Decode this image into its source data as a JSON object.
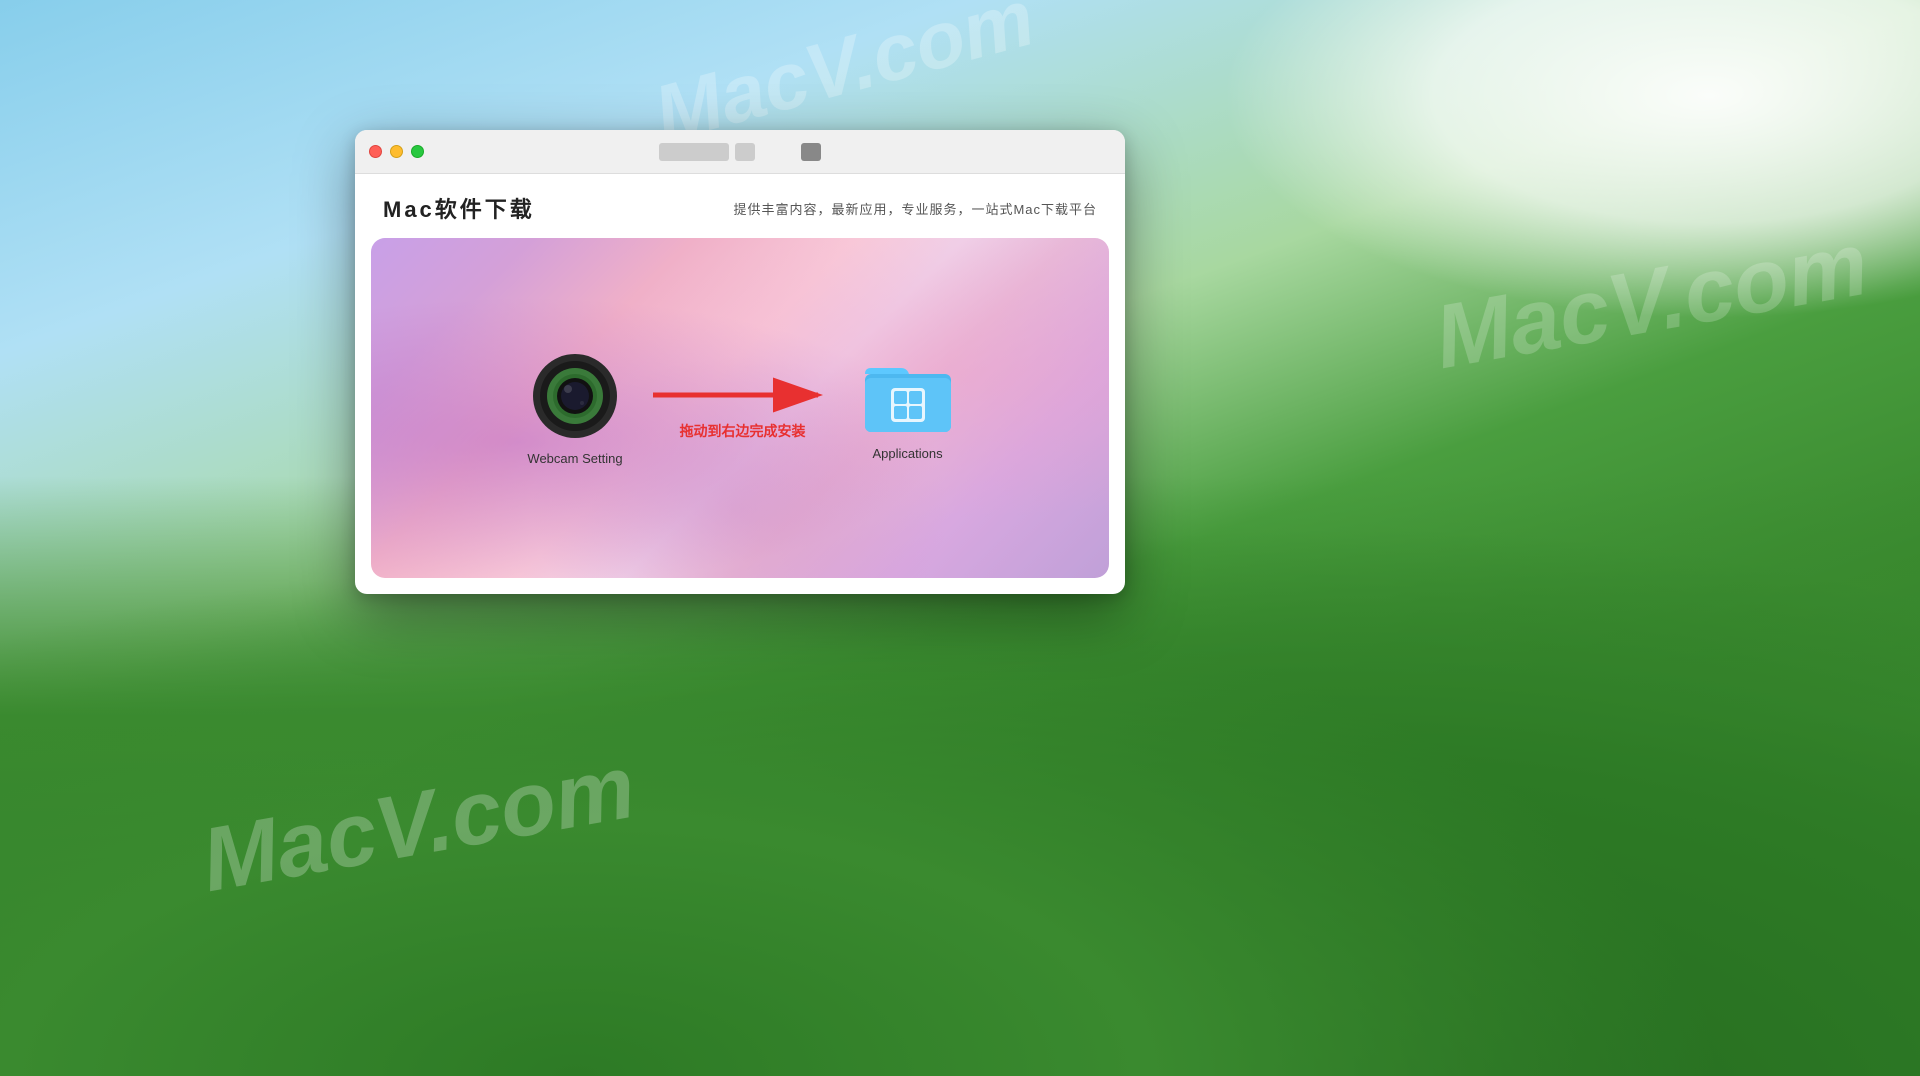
{
  "desktop": {
    "watermarks": [
      "MacV.com",
      "MacV.com",
      "MacV.com"
    ]
  },
  "window": {
    "traffic_lights": {
      "close_label": "close",
      "minimize_label": "minimize",
      "maximize_label": "maximize"
    },
    "header": {
      "title": "Mac软件下载",
      "subtitle": "提供丰富内容，最新应用，专业服务，一站式Mac下载平台"
    },
    "install_area": {
      "app_icon_label": "Webcam Setting",
      "arrow_text": "拖动到右边完成安装",
      "applications_label": "Applications"
    }
  }
}
